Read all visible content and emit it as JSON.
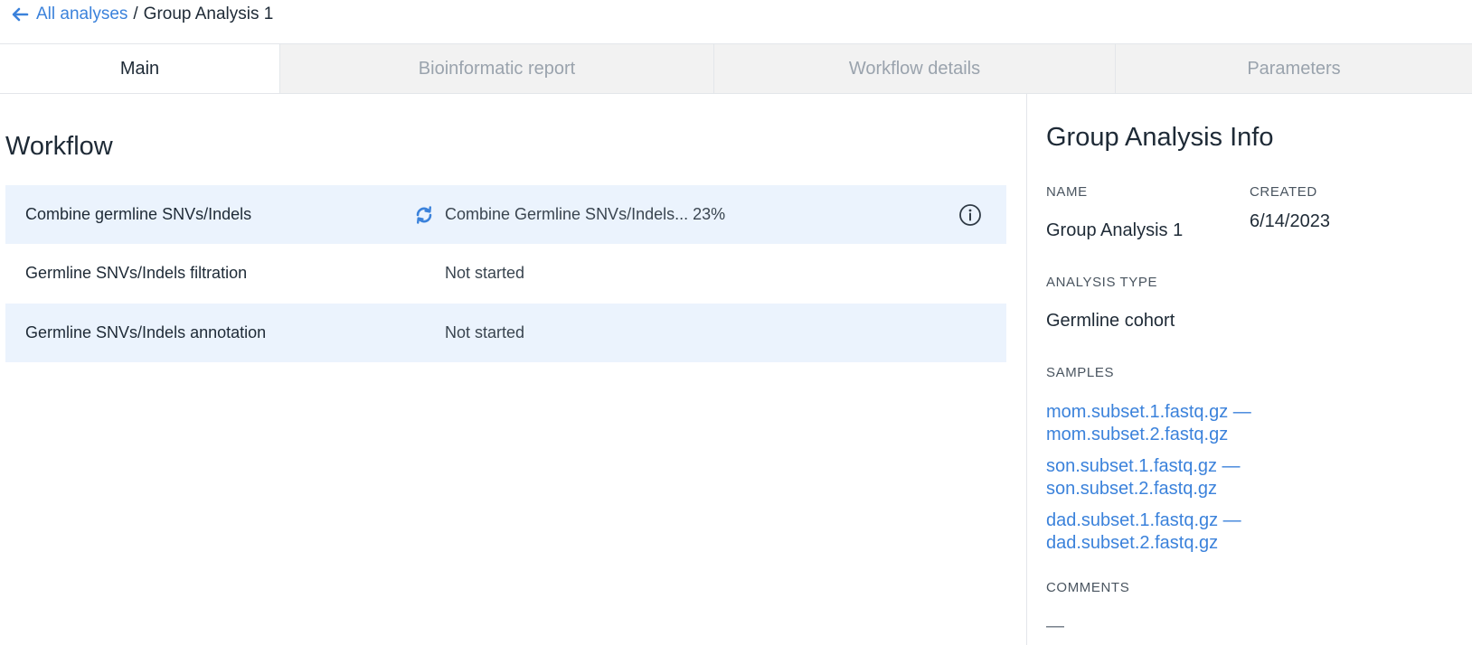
{
  "breadcrumb": {
    "back_label": "All analyses",
    "separator": "/",
    "current": "Group Analysis 1"
  },
  "tabs": [
    {
      "label": "Main",
      "active": true
    },
    {
      "label": "Bioinformatic report",
      "active": false
    },
    {
      "label": "Workflow details",
      "active": false
    },
    {
      "label": "Parameters",
      "active": false
    }
  ],
  "workflow": {
    "title": "Workflow",
    "steps": [
      {
        "name": "Combine germline SNVs/Indels",
        "status": "Combine Germline SNVs/Indels... 23%",
        "progress_percent": 23,
        "running": true
      },
      {
        "name": "Germline SNVs/Indels filtration",
        "status": "Not started",
        "running": false
      },
      {
        "name": "Germline SNVs/Indels annotation",
        "status": "Not started",
        "running": false
      }
    ]
  },
  "info": {
    "title": "Group Analysis Info",
    "name_label": "NAME",
    "name_value": "Group Analysis 1",
    "created_label": "CREATED",
    "created_value": "6/14/2023",
    "type_label": "ANALYSIS TYPE",
    "type_value": "Germline cohort",
    "samples_label": "SAMPLES",
    "samples": [
      {
        "line1": "mom.subset.1.fastq.gz —",
        "line2": "mom.subset.2.fastq.gz"
      },
      {
        "line1": "son.subset.1.fastq.gz —",
        "line2": "son.subset.2.fastq.gz"
      },
      {
        "line1": "dad.subset.1.fastq.gz —",
        "line2": "dad.subset.2.fastq.gz"
      }
    ],
    "comments_label": "COMMENTS",
    "comments_value": "—"
  },
  "colors": {
    "accent": "#3b82db",
    "row_highlight": "#ebf3fd",
    "tab_inactive_bg": "#f2f2f2"
  },
  "icons": {
    "back": "arrow-left-icon",
    "running": "refresh-icon",
    "info": "info-circle-icon"
  }
}
